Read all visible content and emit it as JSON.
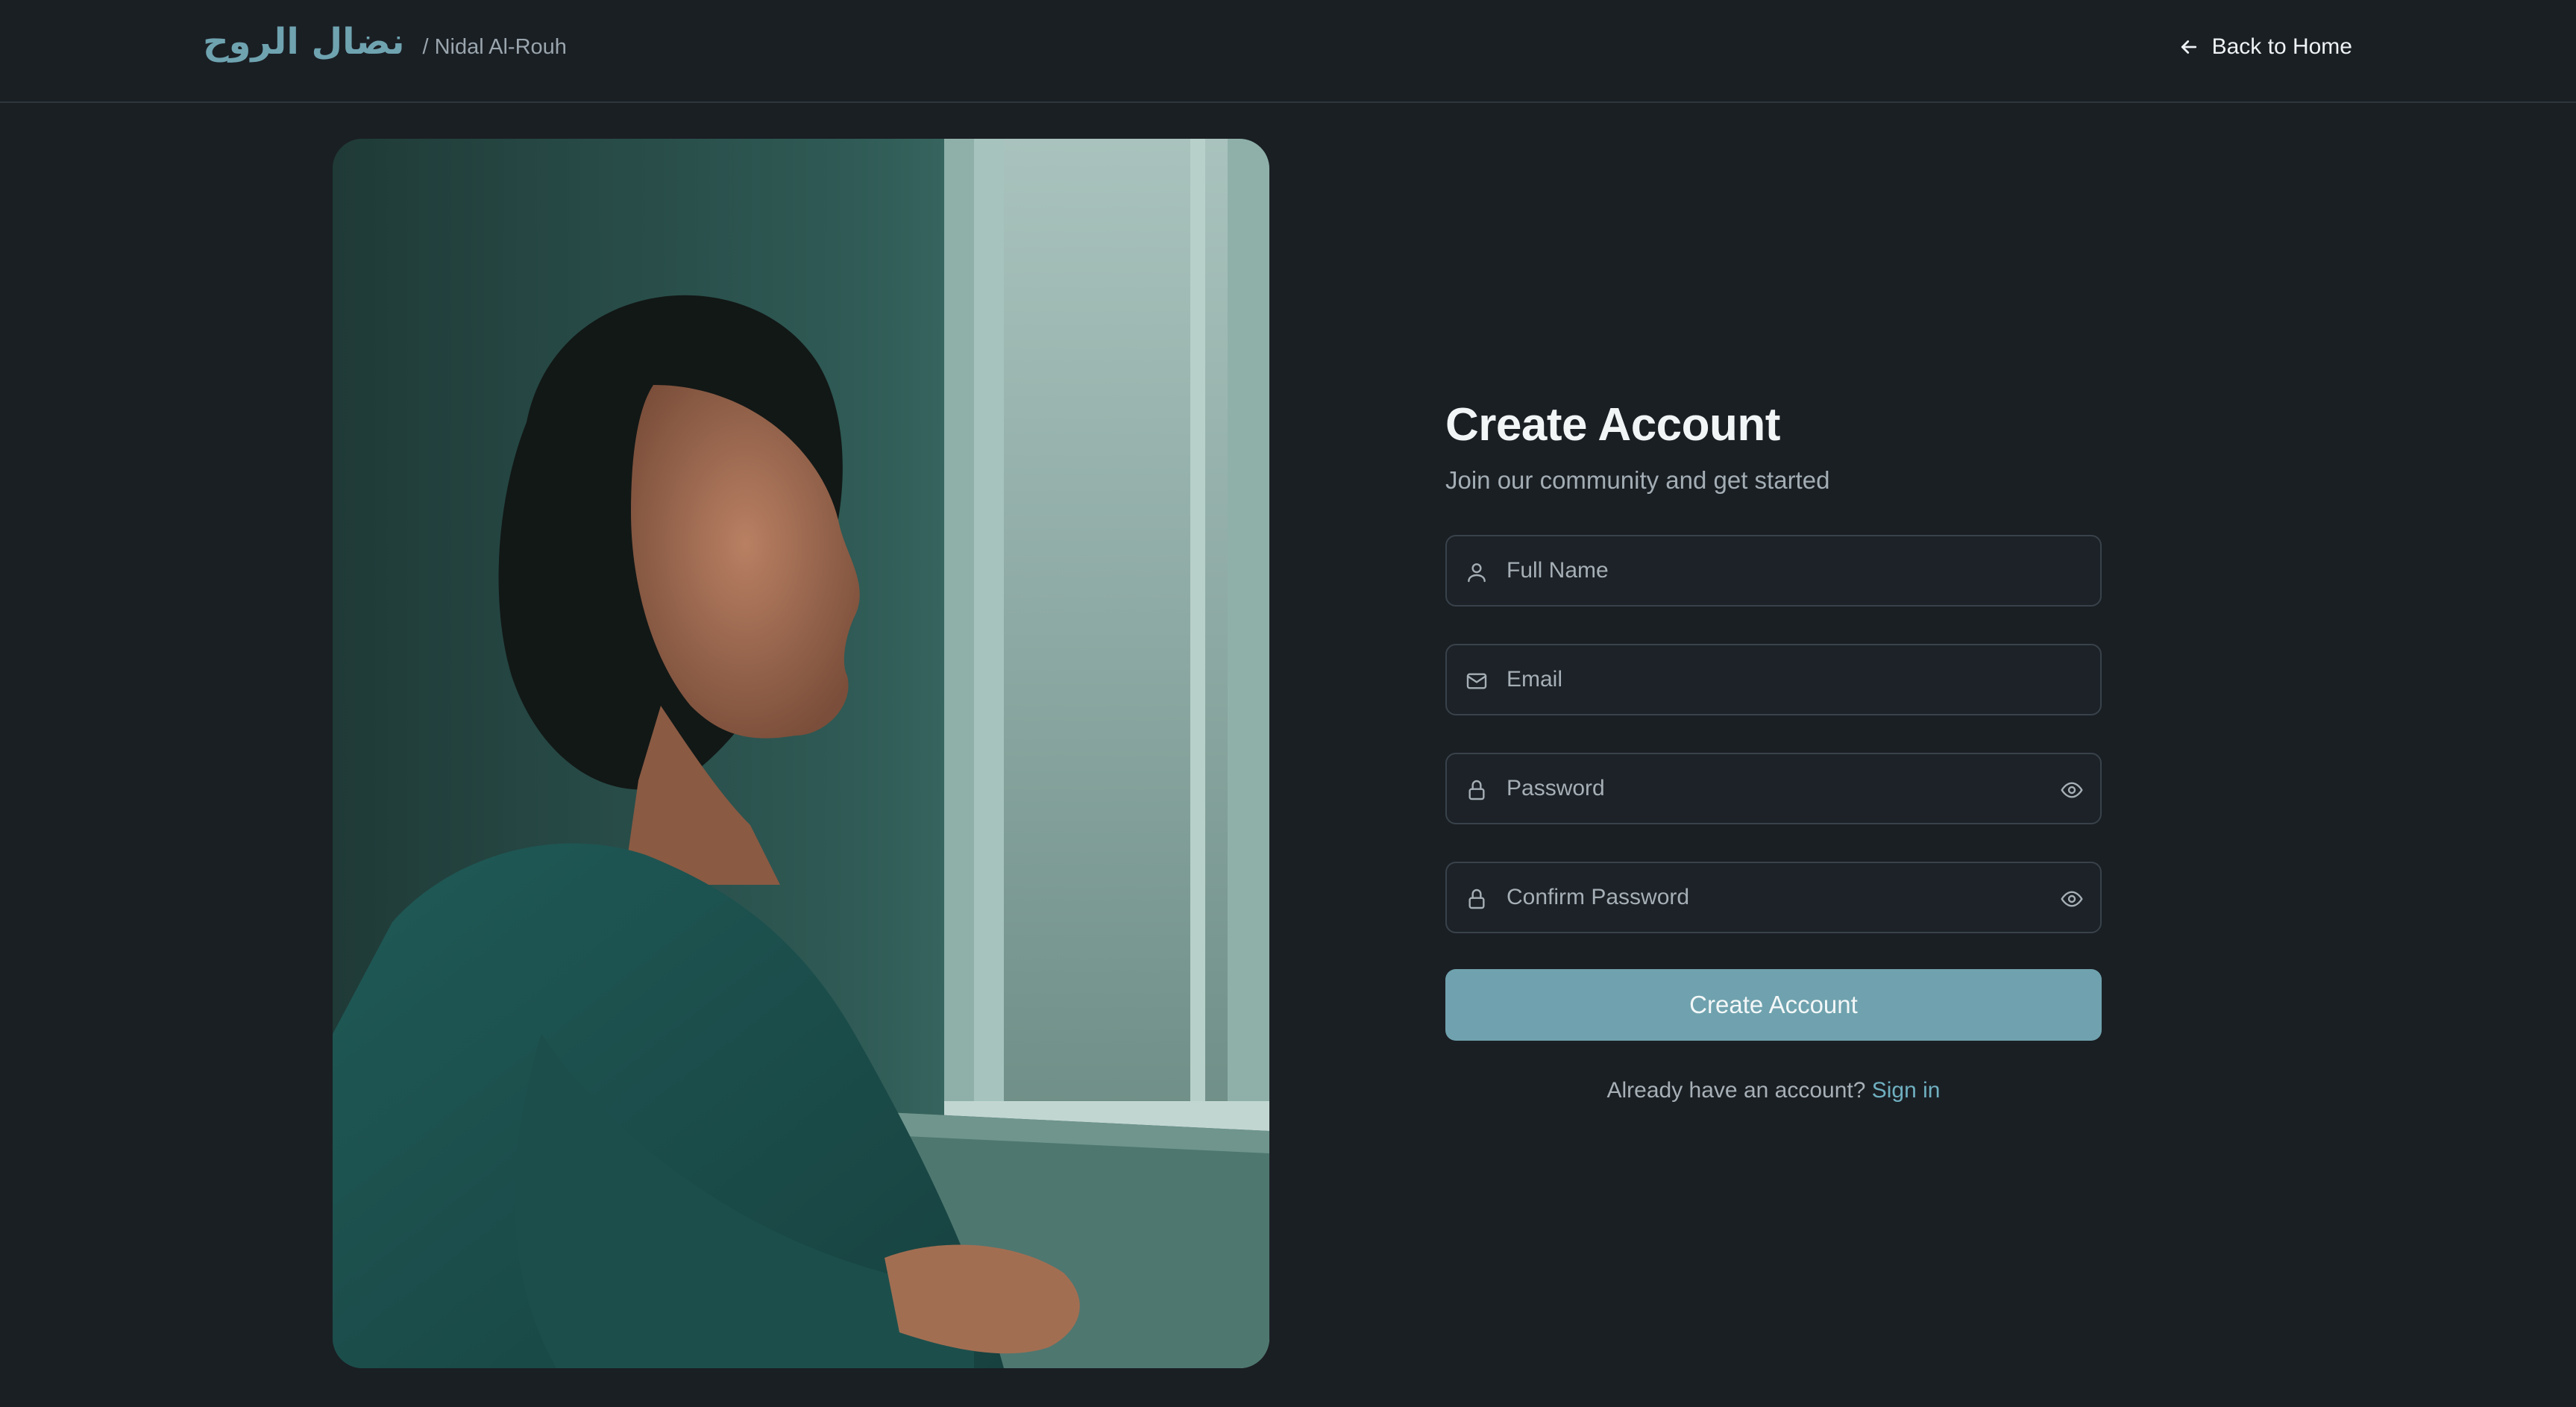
{
  "header": {
    "brand_arabic": "نضال الروح",
    "brand_latin": "/ Nidal Al-Rouh",
    "back_label": "Back to Home"
  },
  "photo": {
    "description_icon": "photo-woman-by-window"
  },
  "form": {
    "title": "Create Account",
    "subtitle": "Join our community and get started",
    "fields": [
      {
        "placeholder": "Full Name",
        "icon": "user-icon",
        "value": ""
      },
      {
        "placeholder": "Email",
        "icon": "mail-icon",
        "value": ""
      },
      {
        "placeholder": "Password",
        "icon": "lock-icon",
        "value": ""
      },
      {
        "placeholder": "Confirm Password",
        "icon": "lock-icon",
        "value": ""
      }
    ],
    "submit_label": "Create Account",
    "signin_prompt": "Already have an account?",
    "signin_link": "Sign in"
  },
  "colors": {
    "background": "#1a1f24",
    "accent": "#6fa2ae",
    "brand": "#6fa3b0",
    "link": "#6fb0c0"
  }
}
